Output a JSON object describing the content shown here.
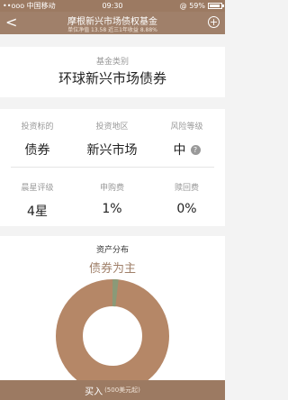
{
  "status": {
    "left": "••ooo 中国移动",
    "time": "09:30",
    "right": "@ 59%"
  },
  "header": {
    "back_icon": "<",
    "title": "摩根新兴市场债权基金",
    "subtitle": "单位净值 13.58 近三1年收益 8.88%",
    "add_icon": "+"
  },
  "fund": {
    "category_label": "基金类别",
    "category_value": "环球新兴市场债券"
  },
  "grid": {
    "row1": [
      {
        "label": "投资标的",
        "value": "债券"
      },
      {
        "label": "投资地区",
        "value": "新兴市场"
      },
      {
        "label": "风险等级",
        "value": "中"
      }
    ],
    "row2": [
      {
        "label": "晨星评级",
        "value": "4星"
      },
      {
        "label": "申购费",
        "value": "1%"
      },
      {
        "label": "赎回费",
        "value": "0%"
      }
    ],
    "help_icon": "?"
  },
  "asset": {
    "title": "资产分布",
    "subtitle": "债券为主"
  },
  "buy": {
    "label": "买入",
    "min": "(500美元起)"
  },
  "colors": {
    "brand": "#a0806a",
    "donut_main": "#b58767",
    "donut_small": "#8a9a78"
  }
}
